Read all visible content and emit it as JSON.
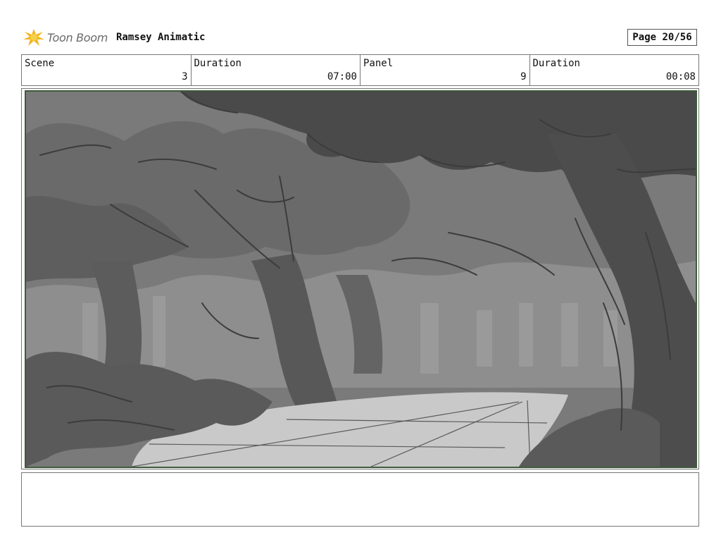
{
  "header": {
    "logo_text": "Toon Boom",
    "project_title": "Ramsey Animatic",
    "page_label": "Page 20/56"
  },
  "info": {
    "scene_label": "Scene",
    "scene_value": "3",
    "scene_duration_label": "Duration",
    "scene_duration_value": "07:00",
    "panel_label": "Panel",
    "panel_value": "9",
    "panel_duration_label": "Duration",
    "panel_duration_value": "00:08"
  },
  "notes": {
    "text": ""
  }
}
